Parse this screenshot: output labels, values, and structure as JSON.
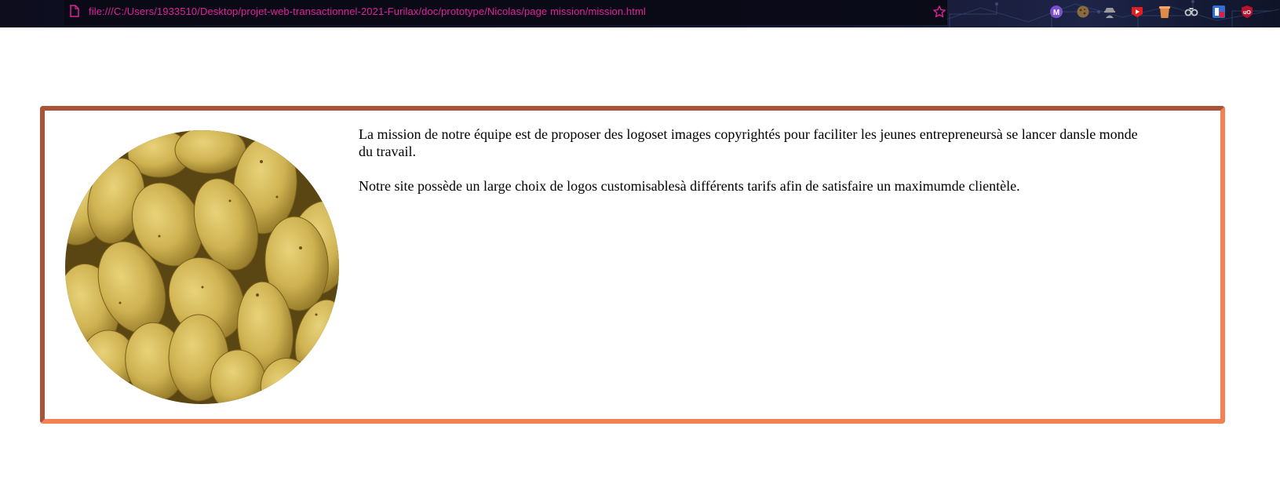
{
  "browser": {
    "url": "file:///C:/Users/1933510/Desktop/projet-web-transactionnel-2021-Furilax/doc/prototype/Nicolas/page mission/mission.html",
    "icons": {
      "page": "page-icon",
      "bookmark": "star-icon"
    },
    "extensions": [
      {
        "name": "m-extension-icon",
        "letter": "M",
        "color": "#7b4fd0"
      },
      {
        "name": "cookie-extension-icon",
        "letter": "",
        "color": "#8a6a3e"
      },
      {
        "name": "spy-extension-icon",
        "letter": "",
        "color": "#9a9a9a"
      },
      {
        "name": "youtube-extension-icon",
        "letter": "",
        "color": "#e41d1d"
      },
      {
        "name": "cup-extension-icon",
        "letter": "",
        "color": "#e08a4a"
      },
      {
        "name": "glasses-extension-icon",
        "letter": "",
        "color": "#c8c8c8"
      },
      {
        "name": "blue-square-extension-icon",
        "letter": "",
        "color": "#2f6fd6"
      },
      {
        "name": "ublock-extension-icon",
        "letter": "uO",
        "color": "#b8122d"
      }
    ],
    "accent_color": "#e0229a"
  },
  "mission": {
    "image": "potatoes-photo",
    "paragraph1": "La mission de notre équipe est de proposer des logoset images copyrightés pour faciliter les jeunes entrepreneursà se lancer dansle monde du travail.",
    "paragraph2": "Notre site possède un large choix de logos customisablesà différents tarifs afin de satisfaire un maximumde clientèle.",
    "border_color_dark": "#a95338",
    "border_color_light": "#f58052"
  }
}
